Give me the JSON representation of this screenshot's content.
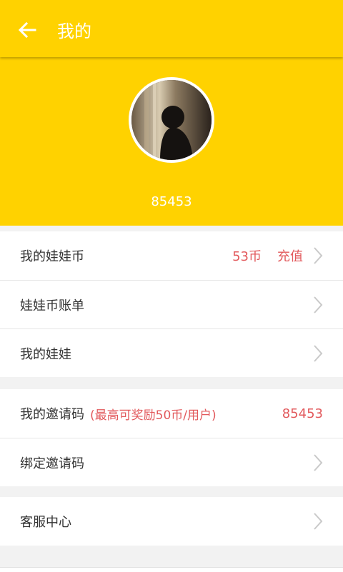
{
  "app": {
    "title": "我的"
  },
  "profile": {
    "user_id": "85453"
  },
  "menu": {
    "group1": [
      {
        "label": "我的娃娃币",
        "value": "53币",
        "action": "充值"
      },
      {
        "label": "娃娃币账单"
      },
      {
        "label": "我的娃娃"
      }
    ],
    "group2": [
      {
        "label": "我的邀请码",
        "note": "(最高可奖励50币/用户)",
        "value": "85453"
      },
      {
        "label": "绑定邀请码"
      }
    ],
    "group3": [
      {
        "label": "客服中心"
      }
    ]
  },
  "icons": {
    "back": "back-arrow-icon",
    "chevron": "chevron-right-icon"
  },
  "colors": {
    "accent": "#ffd200",
    "highlight": "#e2595c"
  }
}
